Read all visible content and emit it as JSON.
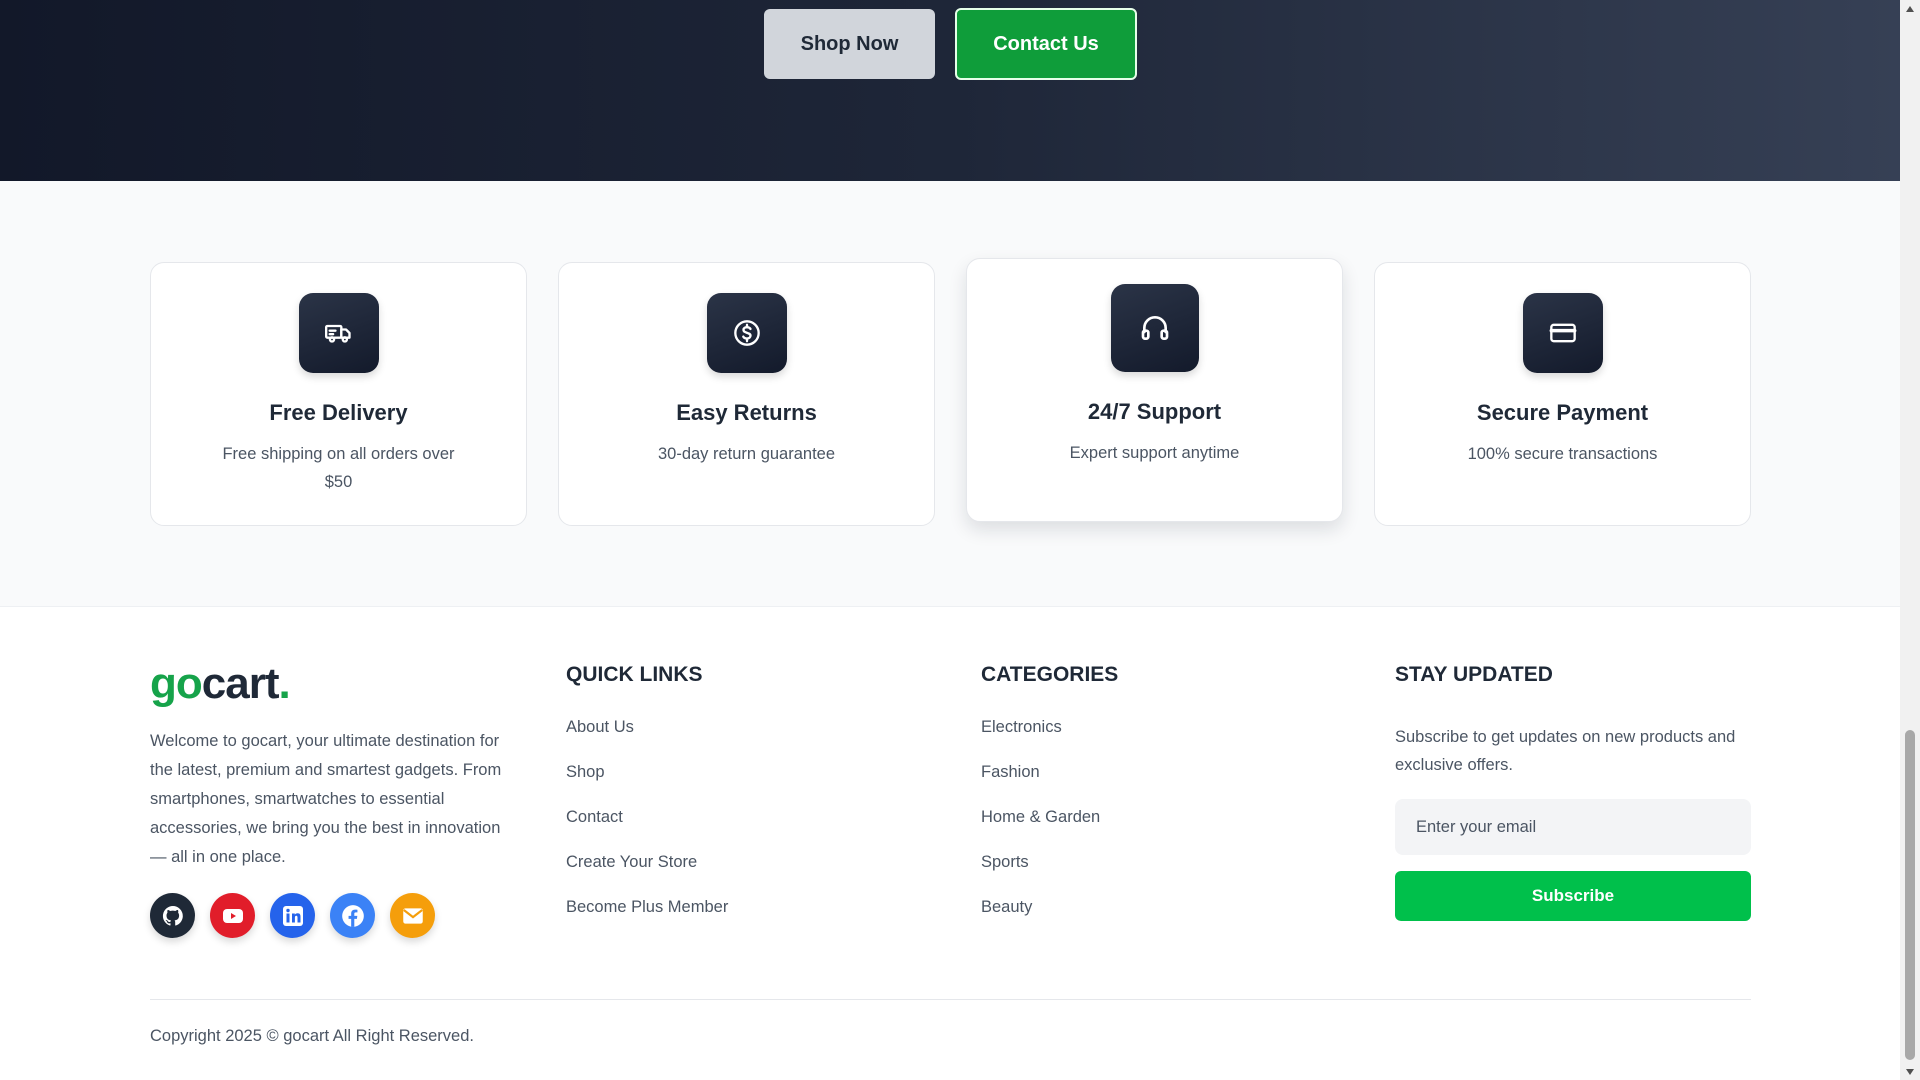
{
  "hero": {
    "shop_label": "Shop Now",
    "contact_label": "Contact Us"
  },
  "features": [
    {
      "icon": "truck-icon",
      "title": "Free Delivery",
      "desc": "Free shipping on all orders over $50"
    },
    {
      "icon": "dollar-icon",
      "title": "Easy Returns",
      "desc": "30-day return guarantee"
    },
    {
      "icon": "headset-icon",
      "title": "24/7 Support",
      "desc": "Expert support anytime"
    },
    {
      "icon": "credit-card-icon",
      "title": "Secure Payment",
      "desc": "100% secure transactions"
    }
  ],
  "footer": {
    "logo_a": "go",
    "logo_b": "cart",
    "logo_dot": ".",
    "about": "Welcome to gocart, your ultimate destination for the latest, premium and smartest gadgets. From smartphones, smartwatches to essential accessories, we bring you the best in innovation — all in one place.",
    "socials": [
      "github-icon",
      "youtube-icon",
      "linkedin-icon",
      "facebook-icon",
      "mail-icon"
    ],
    "quick_links": {
      "heading": "QUICK LINKS",
      "items": [
        "About Us",
        "Shop",
        "Contact",
        "Create Your Store",
        "Become Plus Member"
      ]
    },
    "categories": {
      "heading": "CATEGORIES",
      "items": [
        "Electronics",
        "Fashion",
        "Home & Garden",
        "Sports",
        "Beauty"
      ]
    },
    "newsletter": {
      "heading": "STAY UPDATED",
      "text": "Subscribe to get updates on new products and exclusive offers.",
      "placeholder": "Enter your email",
      "button": "Subscribe"
    },
    "copyright": "Copyright 2025 © gocart All Right Reserved."
  },
  "colors": {
    "brand_green": "#16a34a",
    "subscribe_green": "#00c04b",
    "contact_green": "#0f9d3a",
    "dark": "#1f2937"
  }
}
